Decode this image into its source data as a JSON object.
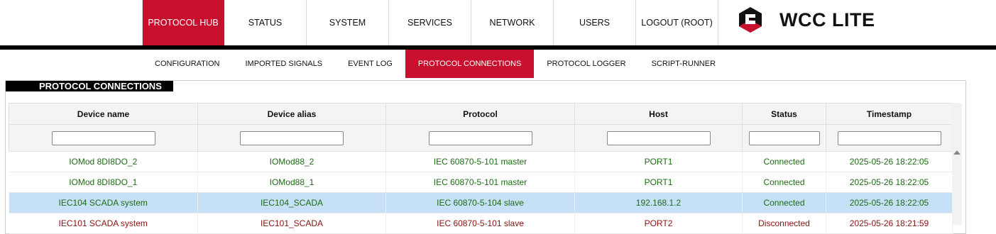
{
  "top_nav": [
    "PROTOCOL HUB",
    "STATUS",
    "SYSTEM",
    "SERVICES",
    "NETWORK",
    "USERS",
    "LOGOUT (ROOT)"
  ],
  "brand": {
    "name": "WCC LITE",
    "accent": "#c8102e"
  },
  "sub_nav": [
    "CONFIGURATION",
    "IMPORTED SIGNALS",
    "EVENT LOG",
    "PROTOCOL CONNECTIONS",
    "PROTOCOL LOGGER",
    "SCRIPT-RUNNER"
  ],
  "panel_title": "PROTOCOL CONNECTIONS",
  "columns": [
    "Device name",
    "Device alias",
    "Protocol",
    "Host",
    "Status",
    "Timestamp"
  ],
  "rows": [
    {
      "name": "IOMod 8DI8DO_2",
      "alias": "IOMod88_2",
      "protocol": "IEC 60870-5-101 master",
      "host": "PORT1",
      "status": "Connected",
      "timestamp": "2025-05-26 18:22:05"
    },
    {
      "name": "IOMod 8DI8DO_1",
      "alias": "IOMod88_1",
      "protocol": "IEC 60870-5-101 master",
      "host": "PORT1",
      "status": "Connected",
      "timestamp": "2025-05-26 18:22:05"
    },
    {
      "name": "IEC104 SCADA system",
      "alias": "IEC104_SCADA",
      "protocol": "IEC 60870-5-104 slave",
      "host": "192.168.1.2",
      "status": "Connected",
      "timestamp": "2025-05-26 18:22:05"
    },
    {
      "name": "IEC101 SCADA system",
      "alias": "IEC101_SCADA",
      "protocol": "IEC 60870-5-101 slave",
      "host": "PORT2",
      "status": "Disconnected",
      "timestamp": "2025-05-26 18:21:59"
    }
  ],
  "status_colors": {
    "connected": "#1d6b14",
    "disconnected": "#8b1010",
    "selected_row": "#c6e0f7"
  }
}
